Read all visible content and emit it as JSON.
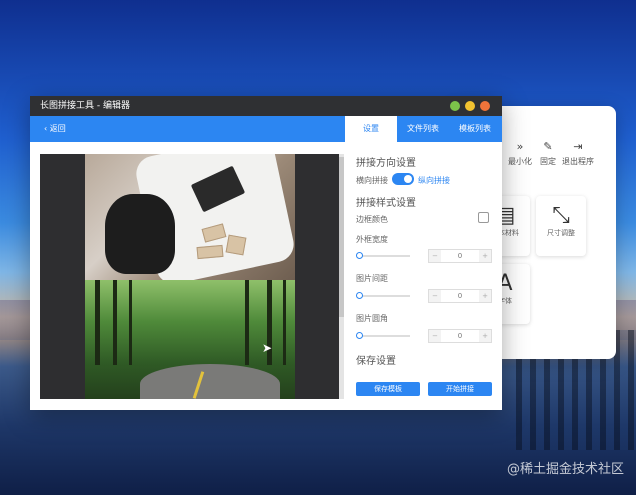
{
  "window": {
    "title": "长图拼接工具 - 编辑器",
    "controls": [
      "minimize-icon",
      "maximize-icon",
      "close-icon"
    ],
    "control_colors": [
      "#7cc24a",
      "#f2c230",
      "#f0743a"
    ]
  },
  "navbar": {
    "back_label": "返回",
    "tabs": [
      {
        "label": "设置",
        "active": true
      },
      {
        "label": "文件列表",
        "active": false
      },
      {
        "label": "模板列表",
        "active": false
      }
    ]
  },
  "settings": {
    "direction_heading": "拼接方向设置",
    "horizontal_label": "横向拼接",
    "vertical_label": "纵向拼接",
    "style_heading": "拼接样式设置",
    "border_color_label": "边框颜色",
    "outer_border_label": "外框宽度",
    "outer_border_value": "0",
    "image_gap_label": "图片间距",
    "image_gap_value": "0",
    "image_radius_label": "图片圆角",
    "image_radius_value": "0",
    "save_heading": "保存设置",
    "save_template_button": "保存模板",
    "start_merge_button": "开始拼接"
  },
  "background_panel": {
    "toolbar": [
      {
        "icon": "chevrons-down-icon",
        "label": "最小化"
      },
      {
        "icon": "pin-icon",
        "label": "固定"
      },
      {
        "icon": "logout-icon",
        "label": "退出程序"
      }
    ],
    "tiles": [
      {
        "icon": "file-icon",
        "label": "文本材料"
      },
      {
        "icon": "shrink-icon",
        "label": "尺寸调整"
      },
      {
        "icon": "font-icon",
        "label": "字体"
      }
    ]
  },
  "watermark": "@稀土掘金技术社区",
  "colors": {
    "accent": "#2c86f2",
    "titlebar": "#2f3033"
  }
}
